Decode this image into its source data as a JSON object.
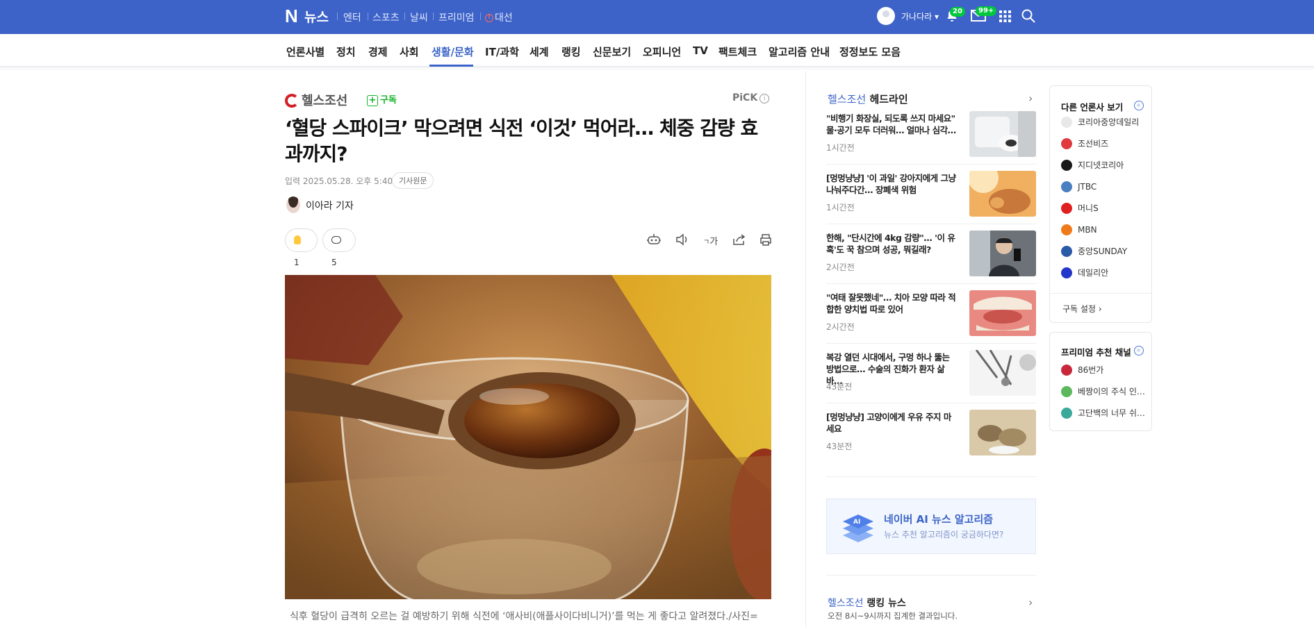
{
  "topbar": {
    "logo": "N",
    "service": "뉴스",
    "nav": [
      "엔터",
      "스포츠",
      "날씨",
      "프리미엄",
      "대선"
    ],
    "user_name": "가나다라",
    "notif_count": "20",
    "mail_count": "99+",
    "bg_color": "#3d63c8"
  },
  "categories": [
    "언론사별",
    "정치",
    "경제",
    "사회",
    "생활/문화",
    "IT/과학",
    "세계",
    "랭킹",
    "신문보기",
    "오피니언",
    "TV",
    "팩트체크",
    "알고리즘 안내",
    "정정보도 모음"
  ],
  "active_category": "생활/문화",
  "article": {
    "publisher": "헬스조선",
    "subscribe": "구독",
    "pick": "PiCK",
    "title": "‘혈당 스파이크’ 막으려면 식전 ‘이것’ 먹어라… 체중 감량 효과까지?",
    "date_label": "입력",
    "date": "2025.05.28. 오후 5:40",
    "origin_button": "기사원문",
    "reporter": "이아라 기자",
    "reaction_count": "1",
    "comment_count": "5",
    "font_size_icon": "가",
    "caption": "식후 혈당이 급격히 오르는 걸 예방하기 위해 식전에 ‘애사비(애플사이다비니거)’를 먹는 게 좋다고 알려졌다./사진="
  },
  "headlines": {
    "publisher": "헬스조선",
    "label": "헤드라인",
    "items": [
      {
        "title": "\"비행기 화장실, 되도록 쓰지 마세요\" 물·공기 모두 더러워… 얼마나 심각…",
        "time": "1시간전"
      },
      {
        "title": "[멍멍냥냥] '이 과일' 강아지에게 그냥 나눠주다간… 장폐색 위험",
        "time": "1시간전"
      },
      {
        "title": "한해, \"단시간에 4kg 감량\"… '이 유혹'도 꾹 참으며 성공, 뭐길래?",
        "time": "2시간전"
      },
      {
        "title": "\"여태 잘못했네\"… 치아 모양 따라 적합한 양치법 따로 있어",
        "time": "2시간전"
      },
      {
        "title": "복강 열던 시대에서, 구멍 하나 뚫는 방법으로… 수술의 진화가 환자 삶 바…",
        "time": "43분전"
      },
      {
        "title": "[멍멍냥냥] 고양이에게 우유 주지 마세요",
        "time": "43분전"
      }
    ]
  },
  "ai_banner": {
    "title": "네이버 AI 뉴스 알고리즘",
    "subtitle": "뉴스 추천 알고리즘이 궁금하다면?",
    "icon_text": "AI"
  },
  "ranking": {
    "publisher": "헬스조선",
    "label": "랭킹 뉴스",
    "subtitle": "오전 8시~9시까지 집계한 결과입니다."
  },
  "other_press": {
    "title": "다른 언론사 보기",
    "items": [
      {
        "name": "코리아중앙데일리",
        "color": "#e8e8e8"
      },
      {
        "name": "조선비즈",
        "color": "#e03a3e"
      },
      {
        "name": "지디넷코리아",
        "color": "#1a1a1a"
      },
      {
        "name": "JTBC",
        "color": "#4a7fc1"
      },
      {
        "name": "머니S",
        "color": "#e02020"
      },
      {
        "name": "MBN",
        "color": "#f07a1a"
      },
      {
        "name": "중앙SUNDAY",
        "color": "#2a5aa8"
      },
      {
        "name": "데일리안",
        "color": "#2436c9"
      }
    ],
    "settings": "구독 설정"
  },
  "premium": {
    "title": "프리미엄 추천 채널",
    "items": [
      {
        "name": "86번가",
        "color": "#c8283a"
      },
      {
        "name": "베짱이의 주식 인…",
        "color": "#5cb85c"
      },
      {
        "name": "고단백의 너무 쉬…",
        "color": "#3aa89a"
      }
    ]
  }
}
